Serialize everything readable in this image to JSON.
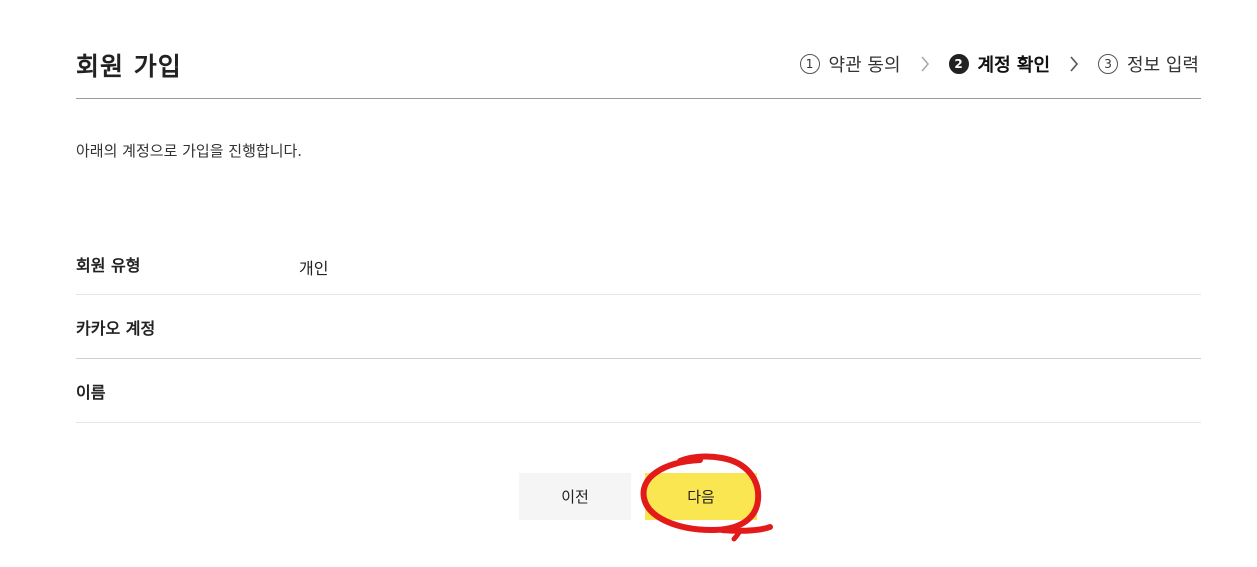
{
  "page": {
    "title": "회원 가입"
  },
  "steps": [
    {
      "number": "1",
      "label": "약관 동의",
      "active": false
    },
    {
      "number": "2",
      "label": "계정 확인",
      "active": true
    },
    {
      "number": "3",
      "label": "정보 입력",
      "active": false
    }
  ],
  "intro_text": "아래의 계정으로 가입을 진행합니다.",
  "info_rows": [
    {
      "label": "회원 유형",
      "value": "개인"
    },
    {
      "label": "카카오 계정",
      "value": ""
    },
    {
      "label": "이름",
      "value": ""
    }
  ],
  "buttons": {
    "prev_label": "이전",
    "next_label": "다음"
  },
  "colors": {
    "next_button_bg": "#fae650",
    "prev_button_bg": "#f5f5f5",
    "annotation_stroke": "#e31a1a"
  },
  "icons": {
    "step_separator": "chevron-right-icon"
  }
}
